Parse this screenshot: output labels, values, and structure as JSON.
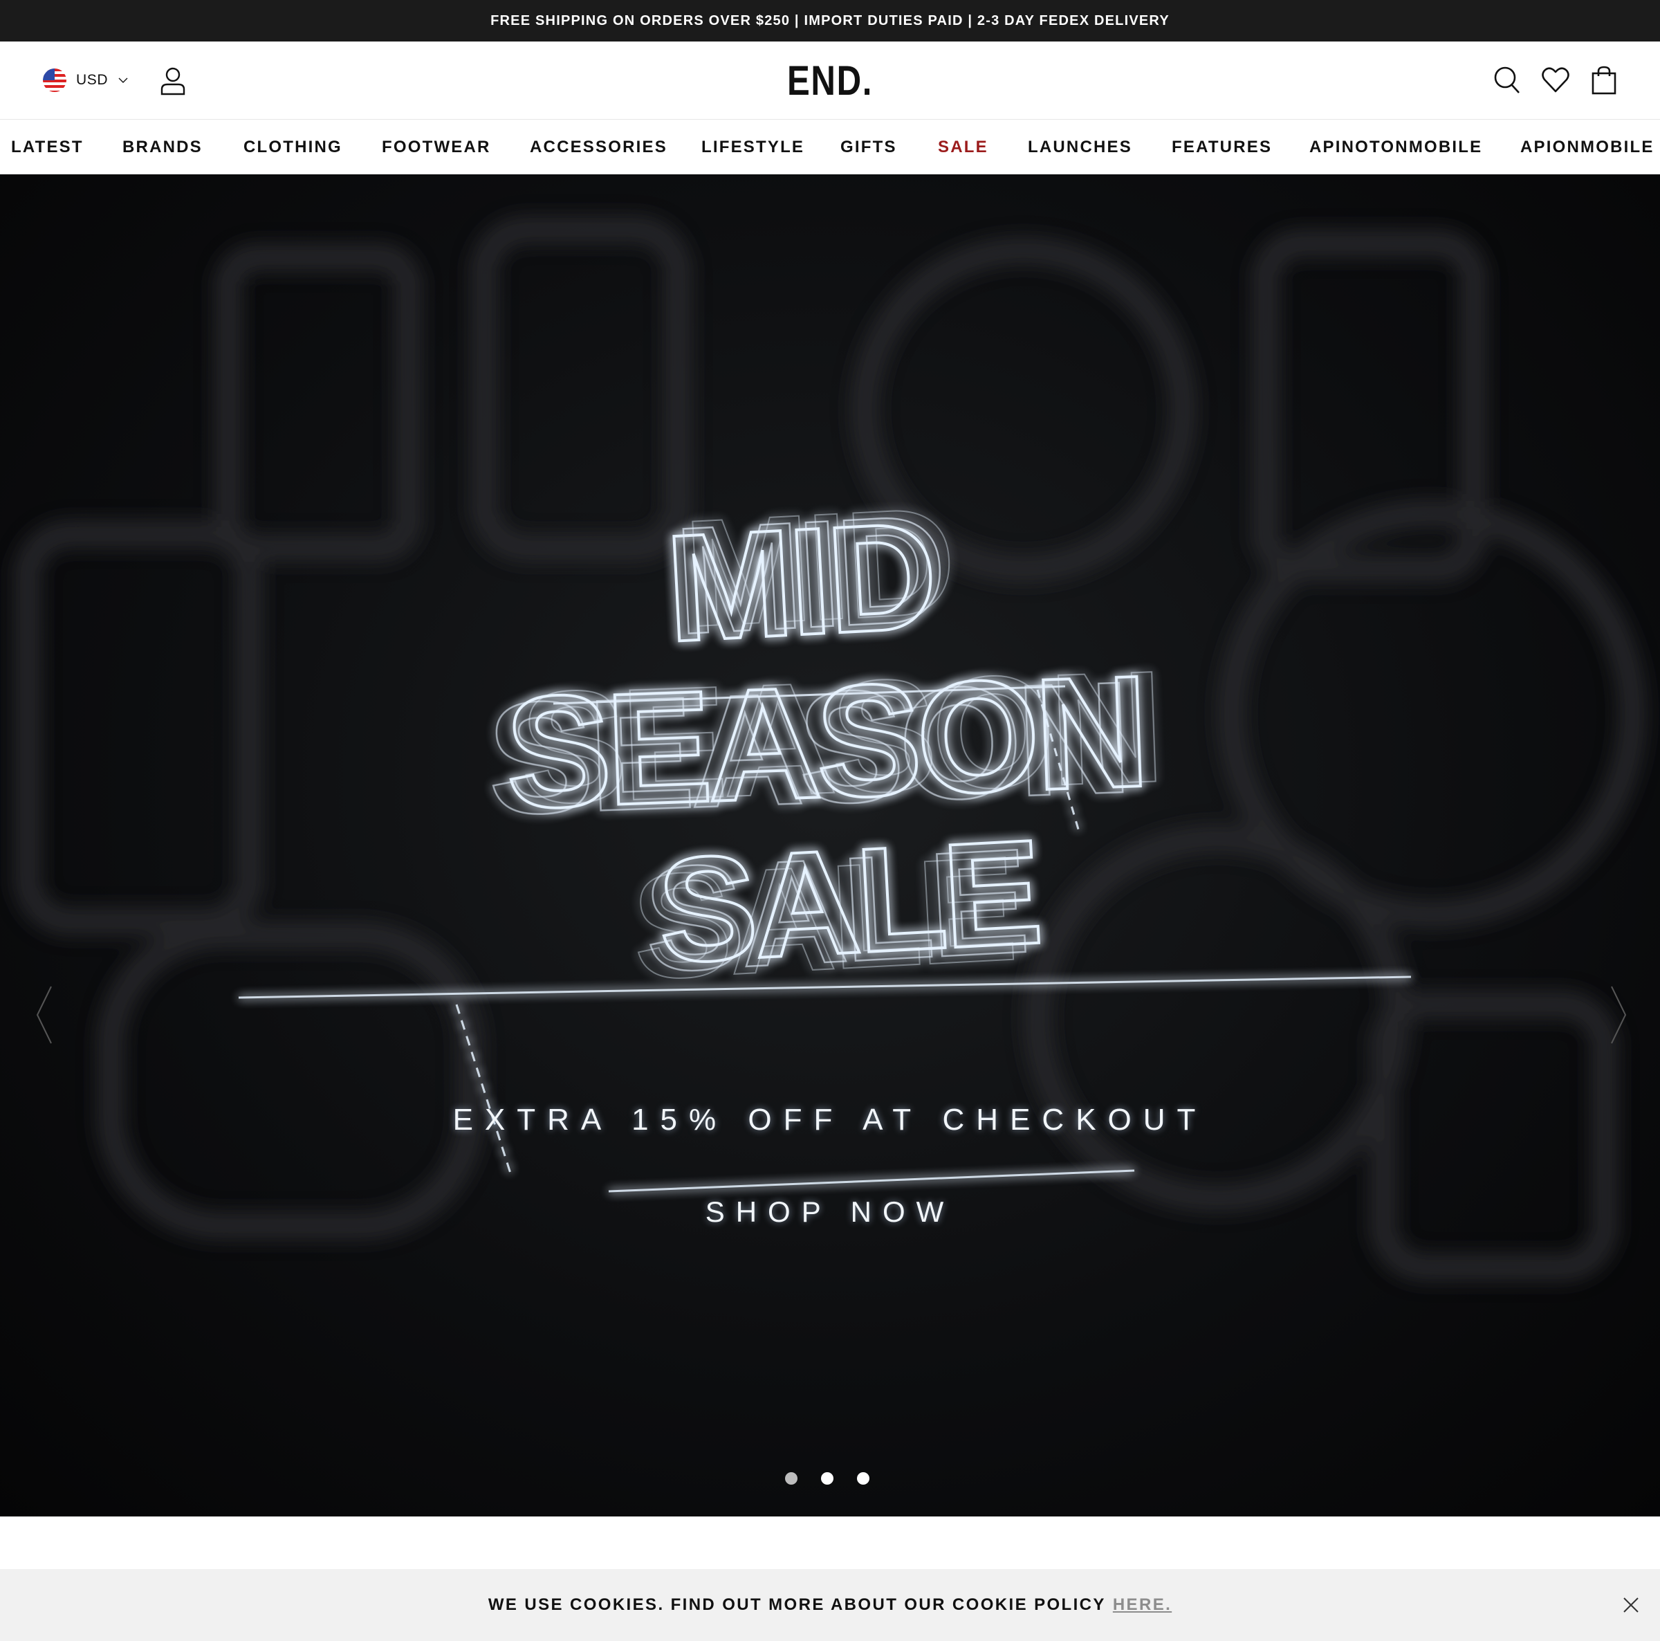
{
  "promo": {
    "text": "FREE SHIPPING ON ORDERS OVER $250 | IMPORT DUTIES PAID | 2-3 DAY FEDEX DELIVERY"
  },
  "header": {
    "currency": "USD",
    "logo": "END.",
    "icons": [
      "flag-us-icon",
      "chevron-down-icon",
      "account-icon",
      "search-icon",
      "heart-icon",
      "bag-icon"
    ]
  },
  "nav": {
    "items": [
      {
        "label": "LATEST"
      },
      {
        "label": "BRANDS"
      },
      {
        "label": "CLOTHING"
      },
      {
        "label": "FOOTWEAR"
      },
      {
        "label": "ACCESSORIES"
      },
      {
        "label": "LIFESTYLE"
      },
      {
        "label": "GIFTS"
      },
      {
        "label": "SALE"
      },
      {
        "label": "LAUNCHES"
      },
      {
        "label": "FEATURES"
      },
      {
        "label": "APINOTONMOBILE"
      },
      {
        "label": "APIONMOBILE"
      }
    ],
    "sale_color": "#9b1b1b"
  },
  "hero": {
    "title_lines": [
      "MID",
      "SEASON",
      "SALE"
    ],
    "subtitle": "EXTRA 15% OFF AT CHECKOUT",
    "cta": "SHOP NOW",
    "slides_total": 3,
    "active_slide": 1
  },
  "cookie": {
    "text": "WE USE COOKIES. FIND OUT MORE ABOUT OUR COOKIE POLICY",
    "link": "HERE."
  },
  "colors": {
    "promo_bg": "#1b1b1b",
    "hero_bg": "#0d0e10",
    "cookie_bg": "#f1f1f1",
    "neon": "#dcecff"
  }
}
